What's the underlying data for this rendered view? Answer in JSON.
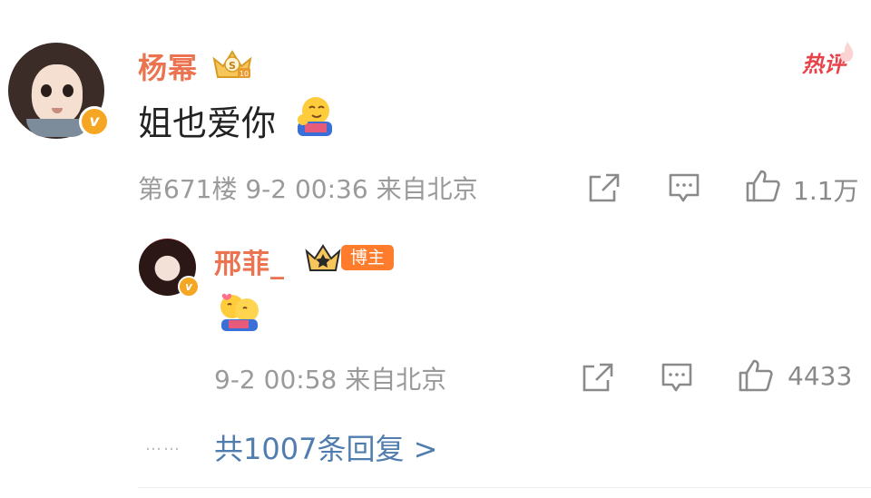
{
  "main_comment": {
    "username": "杨幂",
    "hot_label": "热评",
    "text": "姐也爱你",
    "meta": "第671楼  9-2 00:36  来自北京",
    "like_count": "1.1万",
    "emoji": "hug-emoji",
    "verified_icon": "v-verified-icon",
    "rank_badge_icon": "crown-level-badge-icon"
  },
  "reply": {
    "username": "邢菲_",
    "tag": "博主",
    "meta": "9-2 00:58  来自北京",
    "like_count": "4433",
    "emoji": "hug-emoji"
  },
  "more_replies": {
    "dots": "……",
    "label": "共1007条回复 >"
  },
  "colors": {
    "username": "#eb7350",
    "link": "#507daf",
    "meta": "#9a9a9a",
    "hot": "#e8434b",
    "blogger_tag": "#ff7c2c",
    "verified": "#f5a623"
  }
}
